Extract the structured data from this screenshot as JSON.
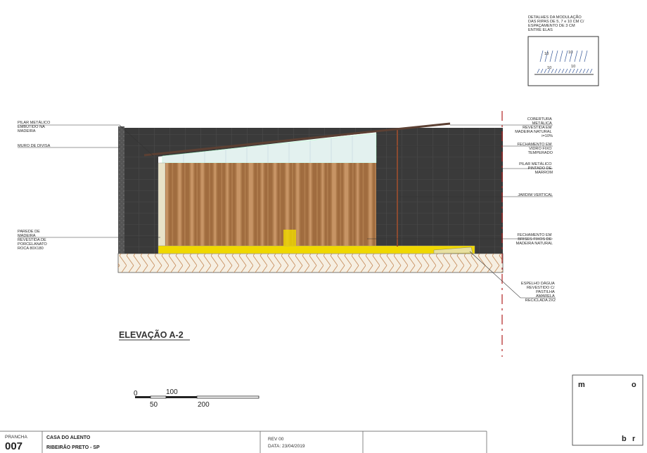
{
  "detail": {
    "lines": [
      "DETALHES DA MODULAÇÃO",
      "DAS RIPAS DE 5, 7 e 10 CM C/",
      "ESPAÇAMENTO DE 3 CM",
      "ENTRE ELAS"
    ],
    "mini_labels": [
      "10",
      "10",
      "10",
      "10"
    ]
  },
  "left_notes": {
    "pilar": [
      "PILAR METÁLICO",
      "EMBUTIDO NA",
      "MADEIRA"
    ],
    "muro": [
      "MURO DE DIVISA"
    ],
    "parede": [
      "PAREDE DE",
      "MADEIRA",
      "REVESTIDA DE",
      "PORCELANATO",
      "ROCA 80X180"
    ]
  },
  "right_notes": {
    "cobertura": [
      "COBERTURA",
      "METÁLICA",
      "REVESTIDA EM",
      "MADEIRA NATURAL",
      "i=10%"
    ],
    "fechamento_vidro": [
      "FECHAMENTO EM",
      "VIDRO FIXO",
      "TEMPERADO"
    ],
    "pilar_pintado": [
      "PILAR METÁLICO",
      "PINTADO DE",
      "MARROM"
    ],
    "jardim": [
      "JARDIM VERTICAL"
    ],
    "fechamento_brises": [
      "FECHAMENTO EM",
      "BRISES FIXOS DE",
      "MADEIRA NATURAL"
    ],
    "espelho": [
      "ESPELHO DÁGUA",
      "REVESTIDO C/",
      "PASTILHA",
      "AMARELA",
      "RECICLADA 2X2"
    ]
  },
  "title": "ELEVAÇÃO A-2",
  "scale_bar": {
    "labels": [
      "0",
      "50",
      "100",
      "200"
    ]
  },
  "title_block": {
    "prancha_label": "PRANCHA",
    "prancha_number": "007",
    "project_name": "CASA DO ALENTO",
    "location": "RIBEIRÃO PRETO - SP",
    "revision": "REV 00",
    "date": "DATA: 23/04/2019"
  },
  "logo": {
    "letters": [
      "m",
      "o",
      "b",
      "r"
    ]
  },
  "colors": {
    "dark_wall": "#3a3a3a",
    "wood": "#b07d4e",
    "glass": "#e3f1ef",
    "yellow_strip": "#f0d800",
    "ground_hatch": "#c89060",
    "ground_fill": "#f6efe2",
    "roof": "#5c4033",
    "red_dash": "#b22222"
  }
}
